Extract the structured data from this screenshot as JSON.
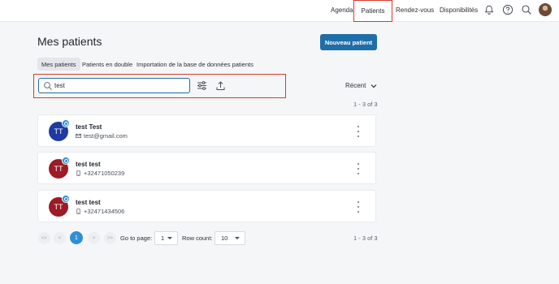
{
  "nav": {
    "agenda": "Agenda",
    "patients": "Patients",
    "rendezvous": "Rendez-vous",
    "disponibilites": "Disponibilités"
  },
  "header": {
    "title": "Mes patients",
    "new_patient_button": "Nouveau patient"
  },
  "tabs": [
    {
      "label": "Mes patients",
      "active": true
    },
    {
      "label": "Patients en double",
      "active": false
    },
    {
      "label": "Importation de la base de données patients",
      "active": false
    }
  ],
  "search": {
    "value": "test"
  },
  "sort": {
    "label": "Récent"
  },
  "results_count_top": "1 - 3 of 3",
  "patients": [
    {
      "initials": "TT",
      "name": "test Test",
      "contact": "test@gmail.com",
      "contact_type": "email",
      "avatar_color": "#1f3aa0"
    },
    {
      "initials": "TT",
      "name": "test test",
      "contact": "+32471050239",
      "contact_type": "phone",
      "avatar_color": "#9b1b26"
    },
    {
      "initials": "TT",
      "name": "test test",
      "contact": "+32471434506",
      "contact_type": "phone",
      "avatar_color": "#9b1b26"
    }
  ],
  "pagination": {
    "first": "<<",
    "prev": "<",
    "current_page": "1",
    "next": ">",
    "last": ">>",
    "go_to_label": "Go to page:",
    "go_to_value": "1",
    "row_count_label": "Row count:",
    "row_count_value": "10",
    "results_count_bottom": "1 - 3 of 3"
  },
  "colors": {
    "primary": "#1e6ea7",
    "highlight": "#d93a2b",
    "badge": "#2f8fd6"
  }
}
